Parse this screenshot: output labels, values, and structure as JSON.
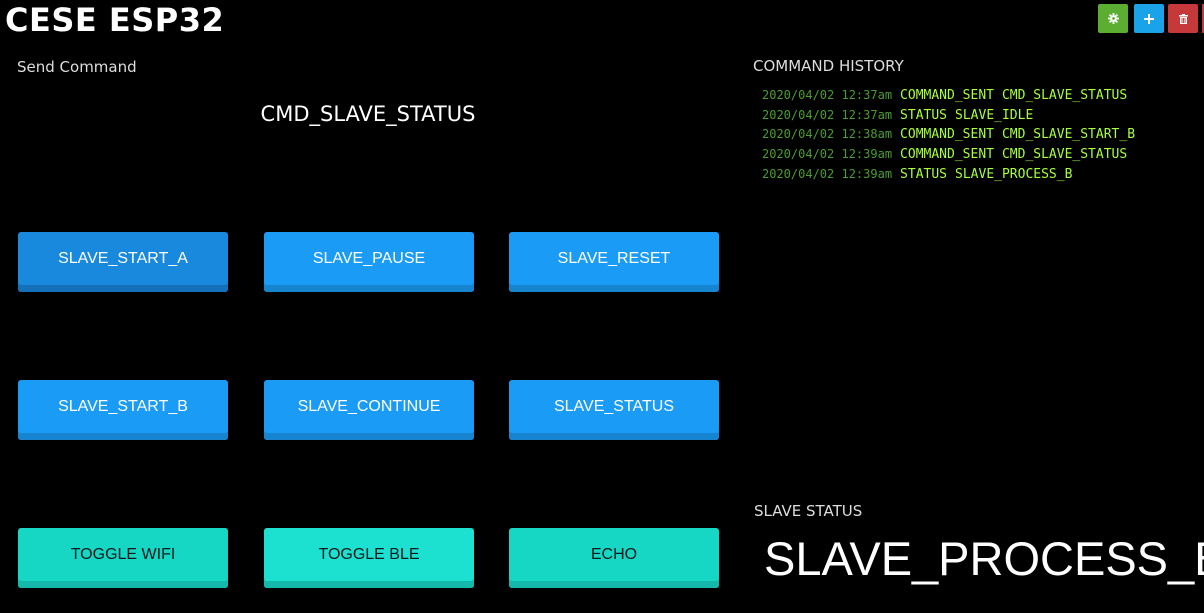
{
  "app": {
    "title": "CESE ESP32"
  },
  "toolbar": {
    "settings_icon": "gear-icon",
    "add_icon": "plus-icon",
    "delete_icon": "trash-icon",
    "colors": {
      "settings": "#5cae33",
      "add": "#1aa3e8",
      "delete": "#c5393b"
    }
  },
  "send_command": {
    "label": "Send Command",
    "current": "CMD_SLAVE_STATUS",
    "buttons": [
      {
        "label": "SLAVE_START_A",
        "style": "blue",
        "active": true
      },
      {
        "label": "SLAVE_PAUSE",
        "style": "blue"
      },
      {
        "label": "SLAVE_RESET",
        "style": "blue"
      },
      {
        "label": "SLAVE_START_B",
        "style": "blue"
      },
      {
        "label": "SLAVE_CONTINUE",
        "style": "blue"
      },
      {
        "label": "SLAVE_STATUS",
        "style": "blue"
      },
      {
        "label": "TOGGLE WIFI",
        "style": "cyan"
      },
      {
        "label": "TOGGLE BLE",
        "style": "cyan"
      },
      {
        "label": "ECHO",
        "style": "cyan"
      }
    ]
  },
  "history": {
    "label": "COMMAND HISTORY",
    "rows": [
      {
        "ts": "2020/04/02 12:37am",
        "kind": "COMMAND_SENT",
        "value": "CMD_SLAVE_STATUS"
      },
      {
        "ts": "2020/04/02 12:37am",
        "kind": "STATUS",
        "value": "SLAVE_IDLE"
      },
      {
        "ts": "2020/04/02 12:38am",
        "kind": "COMMAND_SENT",
        "value": "CMD_SLAVE_START_B"
      },
      {
        "ts": "2020/04/02 12:39am",
        "kind": "COMMAND_SENT",
        "value": "CMD_SLAVE_STATUS"
      },
      {
        "ts": "2020/04/02 12:39am",
        "kind": "STATUS",
        "value": "SLAVE_PROCESS_B"
      }
    ]
  },
  "slave_status": {
    "label": "SLAVE STATUS",
    "value": "SLAVE_PROCESS_B"
  }
}
